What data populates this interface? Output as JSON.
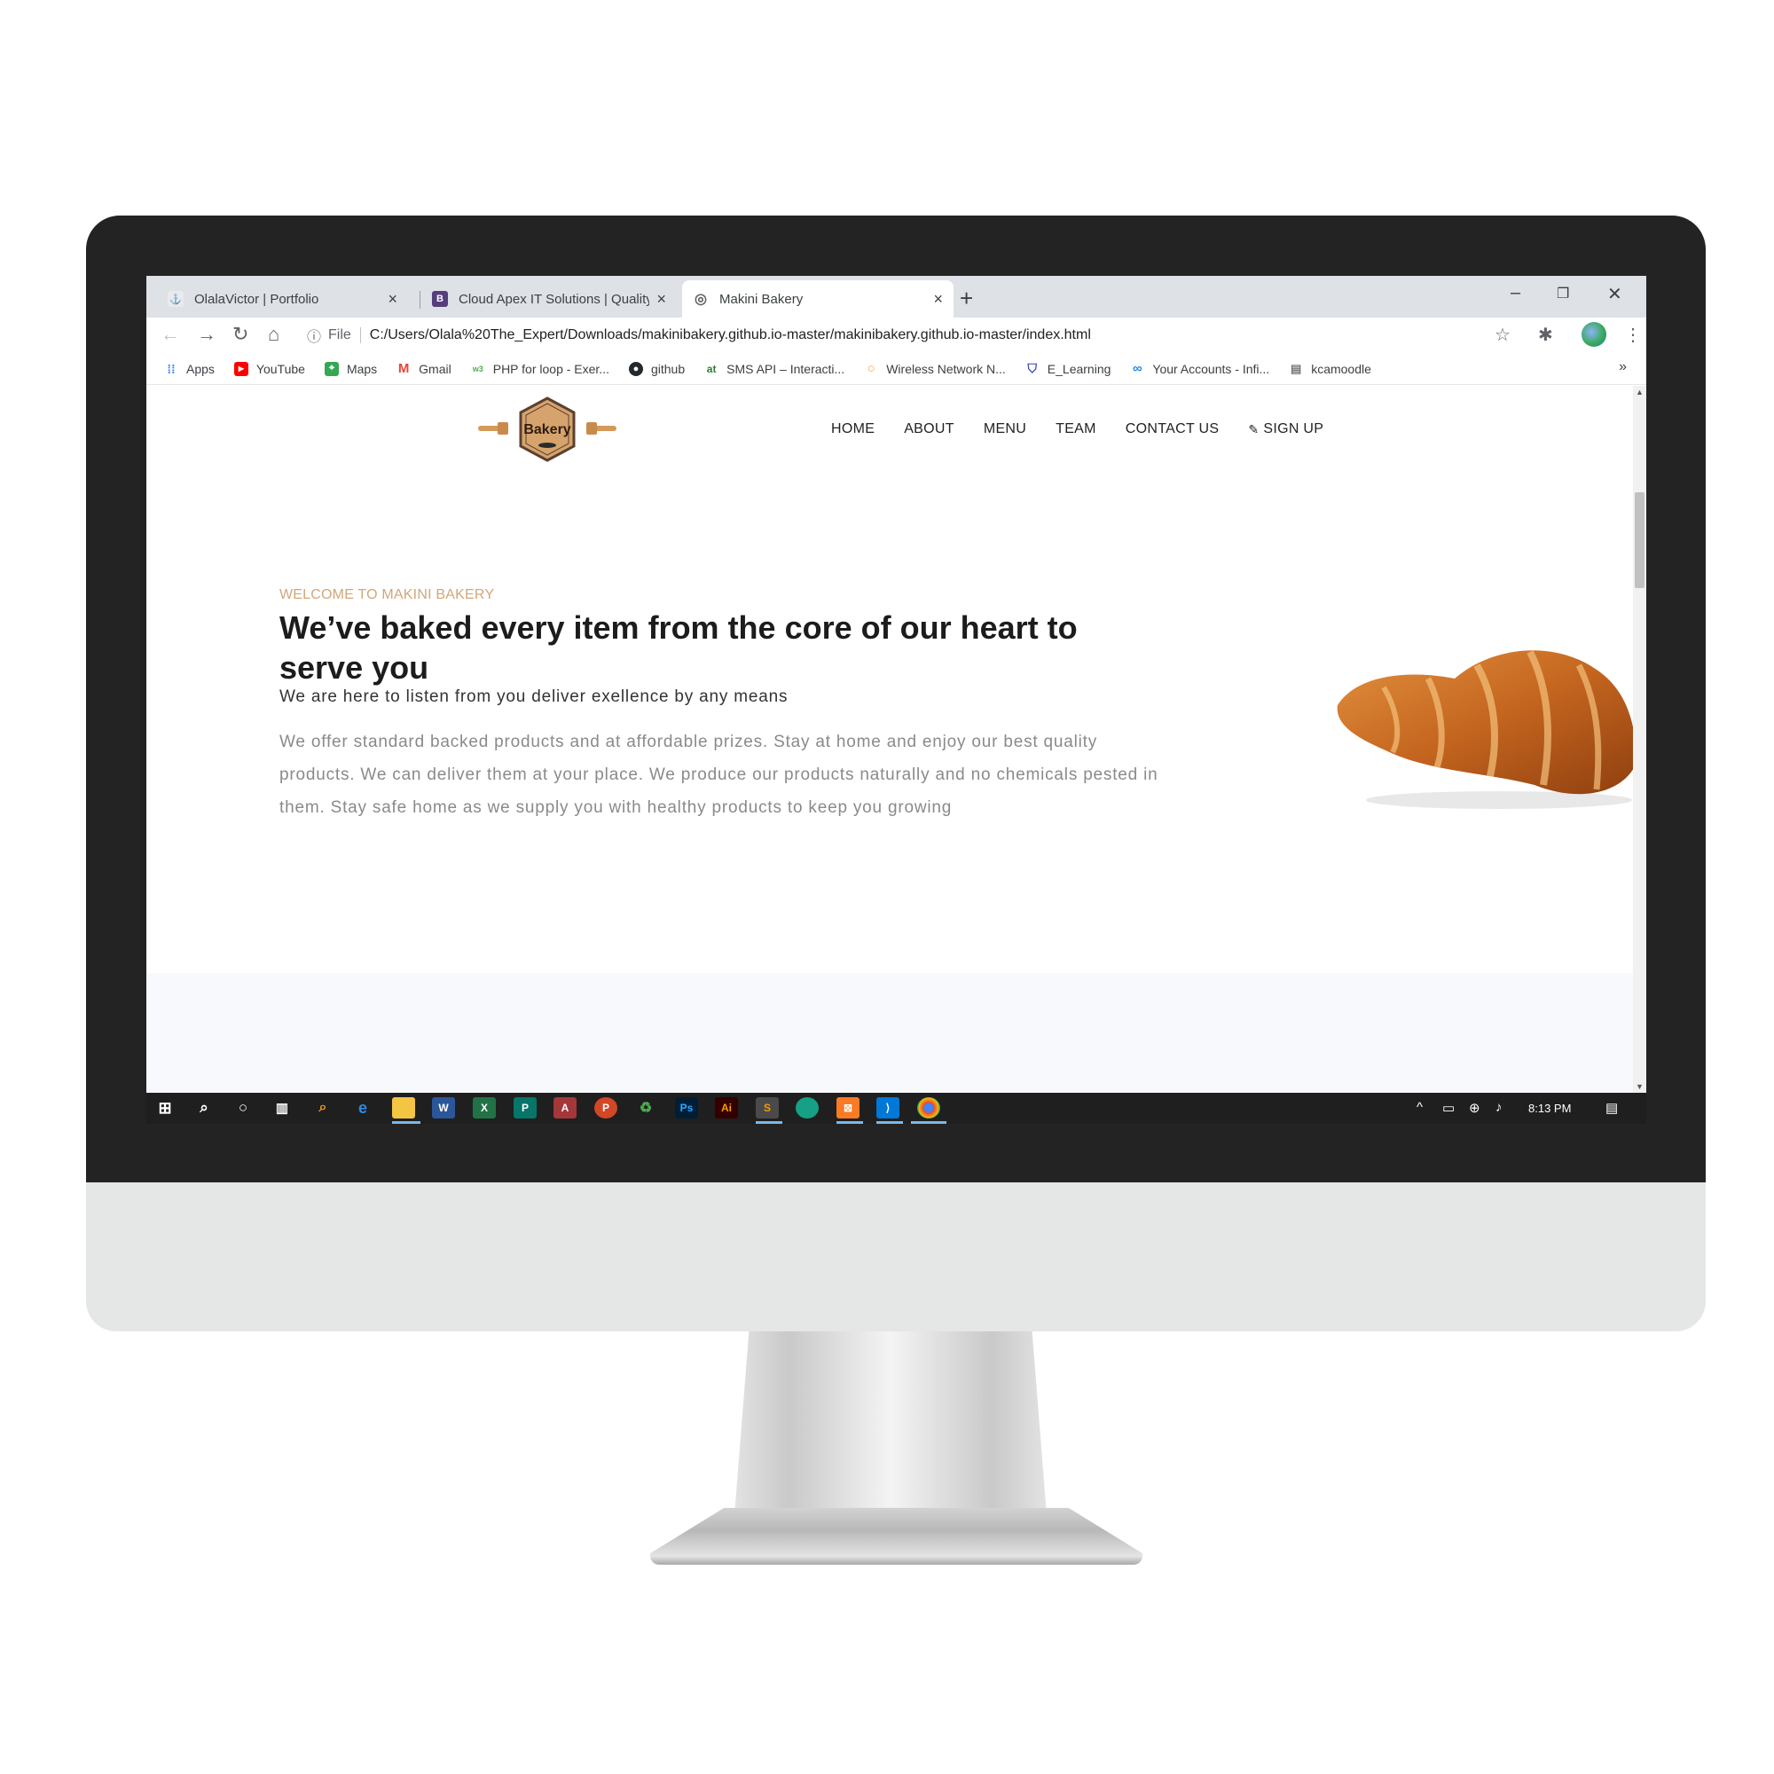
{
  "browser": {
    "tabs": [
      {
        "title": "OlalaVictor | Portfolio",
        "icon": "person-icon",
        "active": false
      },
      {
        "title": "Cloud Apex IT Solutions | Quality",
        "icon": "bootstrap-icon",
        "active": false
      },
      {
        "title": "Makini Bakery",
        "icon": "globe-icon",
        "active": true
      }
    ],
    "new_tab_label": "+",
    "address": {
      "scheme_label": "File",
      "url": "C:/Users/Olala%20The_Expert/Downloads/makinibakery.github.io-master/makinibakery.github.io-master/index.html"
    },
    "bookmarks": [
      {
        "label": "Apps",
        "icon": "apps-grid-icon"
      },
      {
        "label": "YouTube",
        "icon": "youtube-icon"
      },
      {
        "label": "Maps",
        "icon": "maps-icon"
      },
      {
        "label": "Gmail",
        "icon": "gmail-icon"
      },
      {
        "label": "PHP for loop - Exer...",
        "icon": "w3schools-icon"
      },
      {
        "label": "github",
        "icon": "github-icon"
      },
      {
        "label": "SMS API – Interacti...",
        "icon": "sms-icon"
      },
      {
        "label": "Wireless Network N...",
        "icon": "circle-icon"
      },
      {
        "label": "E_Learning",
        "icon": "shield-icon"
      },
      {
        "label": "Your Accounts - Infi...",
        "icon": "infinity-icon"
      },
      {
        "label": "kcamoodle",
        "icon": "moodle-icon"
      }
    ],
    "bookmarks_more": "»"
  },
  "site": {
    "logo_text": "Bakery",
    "menu": [
      {
        "label": "HOME"
      },
      {
        "label": "ABOUT"
      },
      {
        "label": "MENU"
      },
      {
        "label": "TEAM"
      },
      {
        "label": "CONTACT US"
      }
    ],
    "signup_label": "SIGN UP",
    "hero": {
      "eyebrow": "WELCOME TO MAKINI BAKERY",
      "headline": "We’ve baked every item from the core of our heart to serve you",
      "subhead": "We are here to listen from you deliver exellence by any means",
      "body": "We offer standard backed products and at affordable prizes. Stay at home and enjoy our best quality products. We can deliver them at your place. We produce our products naturally and no chemicals pested in them. Stay safe home as we supply you with healthy products to keep you growing"
    }
  },
  "taskbar": {
    "clock": "8:13 PM",
    "apps": [
      "windows-start-icon",
      "search-icon",
      "cortana-icon",
      "task-view-icon",
      "search-app-icon",
      "edge-icon",
      "file-explorer-icon",
      "word-icon",
      "excel-icon",
      "publisher-icon",
      "access-icon",
      "powerpoint-icon",
      "recycle-icon",
      "photoshop-icon",
      "illustrator-icon",
      "sublime-icon",
      "app-icon",
      "xampp-icon",
      "vscode-icon",
      "chrome-icon"
    ]
  },
  "colors": {
    "accent": "#d2a679",
    "headline": "#1c1c1c",
    "body_text": "#8a8a8a",
    "bezel": "#232323",
    "chin": "#e5e6e6"
  }
}
